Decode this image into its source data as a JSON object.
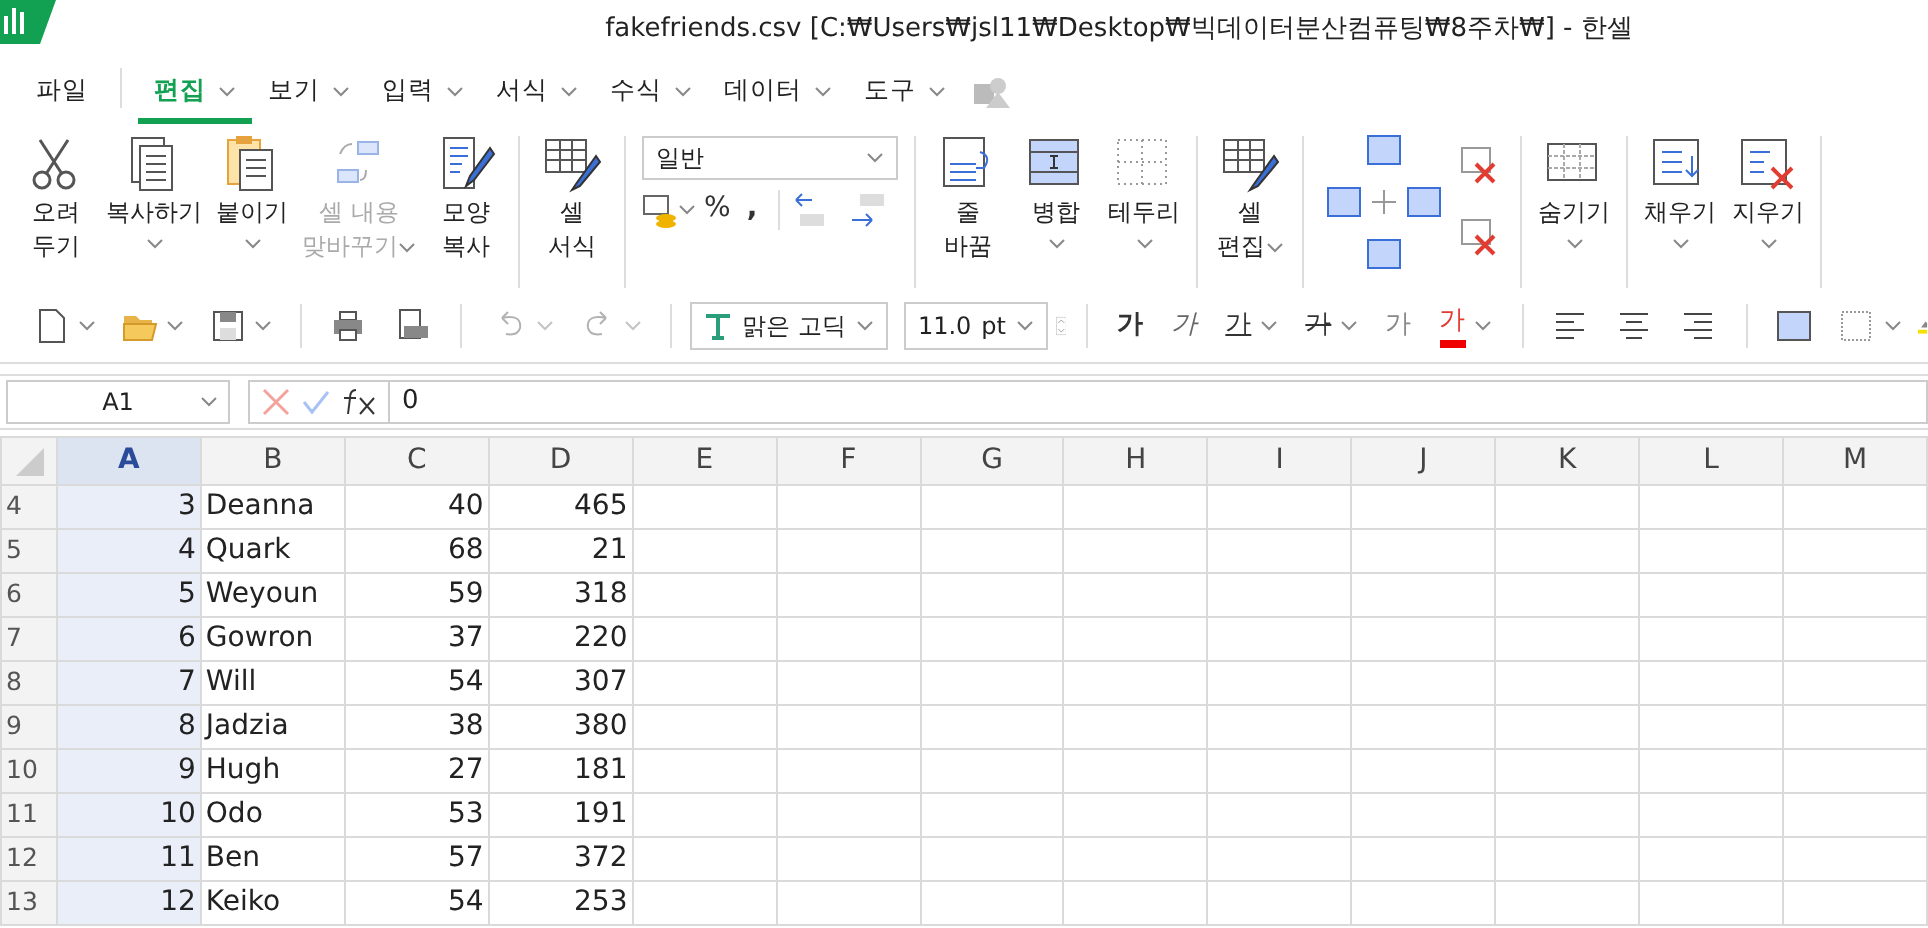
{
  "window": {
    "title": "fakefriends.csv [C:₩Users₩jsl11₩Desktop₩빅데이터분산컴퓨팅₩8주차₩] - 한셀"
  },
  "menu_tabs": [
    {
      "label": "파일",
      "selected": false,
      "caret": false
    },
    {
      "label": "편집",
      "selected": true,
      "caret": true
    },
    {
      "label": "보기",
      "selected": false,
      "caret": true
    },
    {
      "label": "입력",
      "selected": false,
      "caret": true
    },
    {
      "label": "서식",
      "selected": false,
      "caret": true
    },
    {
      "label": "수식",
      "selected": false,
      "caret": true
    },
    {
      "label": "데이터",
      "selected": false,
      "caret": true
    },
    {
      "label": "도구",
      "selected": false,
      "caret": true
    }
  ],
  "ribbon": [
    {
      "kind": "button",
      "label": "오려\n두기",
      "disabled": false,
      "caret_below": false,
      "caret_inline": false
    },
    {
      "kind": "button",
      "label": "복사하기",
      "disabled": false,
      "caret_below": true,
      "caret_inline": false
    },
    {
      "kind": "button",
      "label": "붙이기",
      "disabled": false,
      "caret_below": true,
      "caret_inline": false
    },
    {
      "kind": "button",
      "label": "셀 내용\n맞바꾸기",
      "disabled": true,
      "caret_below": false,
      "caret_inline": true
    },
    {
      "kind": "button",
      "label": "모양\n복사",
      "disabled": false,
      "caret_below": false,
      "caret_inline": false
    },
    {
      "kind": "separator"
    },
    {
      "kind": "button",
      "label": "셀\n서식",
      "disabled": false,
      "caret_below": false,
      "caret_inline": false
    },
    {
      "kind": "separator"
    },
    {
      "kind": "number_format",
      "value": "일반",
      "percent": "%",
      "comma": ","
    },
    {
      "kind": "separator"
    },
    {
      "kind": "button",
      "label": "줄\n바꿈",
      "disabled": false,
      "caret_below": false,
      "caret_inline": false
    },
    {
      "kind": "button",
      "label": "병합",
      "disabled": false,
      "caret_below": true,
      "caret_inline": false
    },
    {
      "kind": "button",
      "label": "테두리",
      "disabled": false,
      "caret_below": true,
      "caret_inline": false
    },
    {
      "kind": "separator"
    },
    {
      "kind": "button",
      "label": "셀\n편집",
      "disabled": false,
      "caret_below": false,
      "caret_inline": true
    },
    {
      "kind": "separator"
    },
    {
      "kind": "insert_delete"
    },
    {
      "kind": "separator"
    },
    {
      "kind": "button",
      "label": "숨기기",
      "disabled": false,
      "caret_below": true,
      "caret_inline": false
    },
    {
      "kind": "separator"
    },
    {
      "kind": "button",
      "label": "채우기",
      "disabled": false,
      "caret_below": true,
      "caret_inline": false
    },
    {
      "kind": "button",
      "label": "지우기",
      "disabled": false,
      "caret_below": true,
      "caret_inline": false
    },
    {
      "kind": "separator"
    }
  ],
  "toolbar": {
    "font": "맑은 고딕",
    "size": "11.0",
    "unit": "pt",
    "char_buttons": [
      {
        "label": "가",
        "kind": "bold",
        "caret": false
      },
      {
        "label": "가",
        "kind": "italic",
        "caret": false
      },
      {
        "label": "가",
        "kind": "underline",
        "caret": true
      },
      {
        "label": "가",
        "kind": "strike",
        "caret": true
      },
      {
        "label": "가",
        "kind": "outline",
        "caret": false
      },
      {
        "label": "가",
        "kind": "color",
        "caret": true
      }
    ]
  },
  "formula_bar": {
    "name_box": "A1",
    "formula": "0"
  },
  "columns": [
    {
      "label": "A",
      "selected": true
    },
    {
      "label": "B",
      "selected": false
    },
    {
      "label": "C",
      "selected": false
    },
    {
      "label": "D",
      "selected": false
    },
    {
      "label": "E",
      "selected": false
    },
    {
      "label": "F",
      "selected": false
    },
    {
      "label": "G",
      "selected": false
    },
    {
      "label": "H",
      "selected": false
    },
    {
      "label": "I",
      "selected": false
    },
    {
      "label": "J",
      "selected": false
    },
    {
      "label": "K",
      "selected": false
    },
    {
      "label": "L",
      "selected": false
    },
    {
      "label": "M",
      "selected": false
    }
  ],
  "rows": [
    {
      "number": "4",
      "cells": [
        "3",
        "Deanna",
        "40",
        "465"
      ]
    },
    {
      "number": "5",
      "cells": [
        "4",
        "Quark",
        "68",
        "21"
      ]
    },
    {
      "number": "6",
      "cells": [
        "5",
        "Weyoun",
        "59",
        "318"
      ]
    },
    {
      "number": "7",
      "cells": [
        "6",
        "Gowron",
        "37",
        "220"
      ]
    },
    {
      "number": "8",
      "cells": [
        "7",
        "Will",
        "54",
        "307"
      ]
    },
    {
      "number": "9",
      "cells": [
        "8",
        "Jadzia",
        "38",
        "380"
      ]
    },
    {
      "number": "10",
      "cells": [
        "9",
        "Hugh",
        "27",
        "181"
      ]
    },
    {
      "number": "11",
      "cells": [
        "10",
        "Odo",
        "53",
        "191"
      ]
    },
    {
      "number": "12",
      "cells": [
        "11",
        "Ben",
        "57",
        "372"
      ]
    },
    {
      "number": "13",
      "cells": [
        "12",
        "Keiko",
        "54",
        "253"
      ]
    }
  ]
}
